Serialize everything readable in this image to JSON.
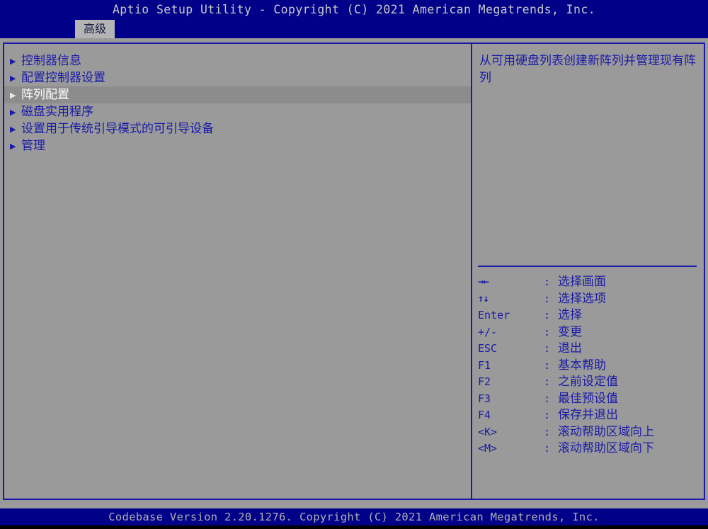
{
  "titlebar": {
    "text": "Aptio Setup Utility - Copyright (C) 2021 American Megatrends, Inc."
  },
  "tabs": [
    {
      "label": "高级",
      "active": true
    }
  ],
  "menu": {
    "items": [
      {
        "label": "控制器信息",
        "bullet": "▶",
        "selected": false
      },
      {
        "label": "配置控制器设置",
        "bullet": "▶",
        "selected": false
      },
      {
        "label": "阵列配置",
        "bullet": "▶",
        "selected": true
      },
      {
        "label": "磁盘实用程序",
        "bullet": "▶",
        "selected": false
      },
      {
        "label": "设置用于传统引导模式的可引导设备",
        "bullet": "▶",
        "selected": false
      },
      {
        "label": "管理",
        "bullet": "▶",
        "selected": false
      }
    ]
  },
  "help": {
    "text": "从可用硬盘列表创建新阵列并管理现有阵列"
  },
  "legend": {
    "rows": [
      {
        "key": "→←",
        "colon": ":",
        "desc": "选择画面",
        "arrows": true
      },
      {
        "key": "↑↓",
        "colon": ":",
        "desc": "选择选项",
        "arrows": true
      },
      {
        "key": "Enter",
        "colon": ":",
        "desc": "选择",
        "arrows": false
      },
      {
        "key": "+/-",
        "colon": ":",
        "desc": "变更",
        "arrows": false
      },
      {
        "key": "ESC",
        "colon": ":",
        "desc": "退出",
        "arrows": false
      },
      {
        "key": "F1",
        "colon": ":",
        "desc": "基本帮助",
        "arrows": false
      },
      {
        "key": "F2",
        "colon": ":",
        "desc": "之前设定值",
        "arrows": false
      },
      {
        "key": "F3",
        "colon": ":",
        "desc": "最佳预设值",
        "arrows": false
      },
      {
        "key": "F4",
        "colon": ":",
        "desc": "保存并退出",
        "arrows": false
      },
      {
        "key": "<K>",
        "colon": ":",
        "desc": "滚动帮助区域向上",
        "arrows": false
      },
      {
        "key": "<M>",
        "colon": ":",
        "desc": "滚动帮助区域向下",
        "arrows": false
      }
    ]
  },
  "footer": {
    "text": "Codebase Version 2.20.1276. Copyright (C) 2021 American Megatrends, Inc."
  },
  "colors": {
    "background": "#9a9a9a",
    "bar_blue": "#000089",
    "border_blue": "#1a1aa8",
    "text_blue": "#1a1aa8",
    "bar_text": "#c9c9c9",
    "tab_active_bg": "#b4b4b4",
    "selected_row_bg": "#8c8c8c",
    "selected_row_text": "#ffffff"
  }
}
